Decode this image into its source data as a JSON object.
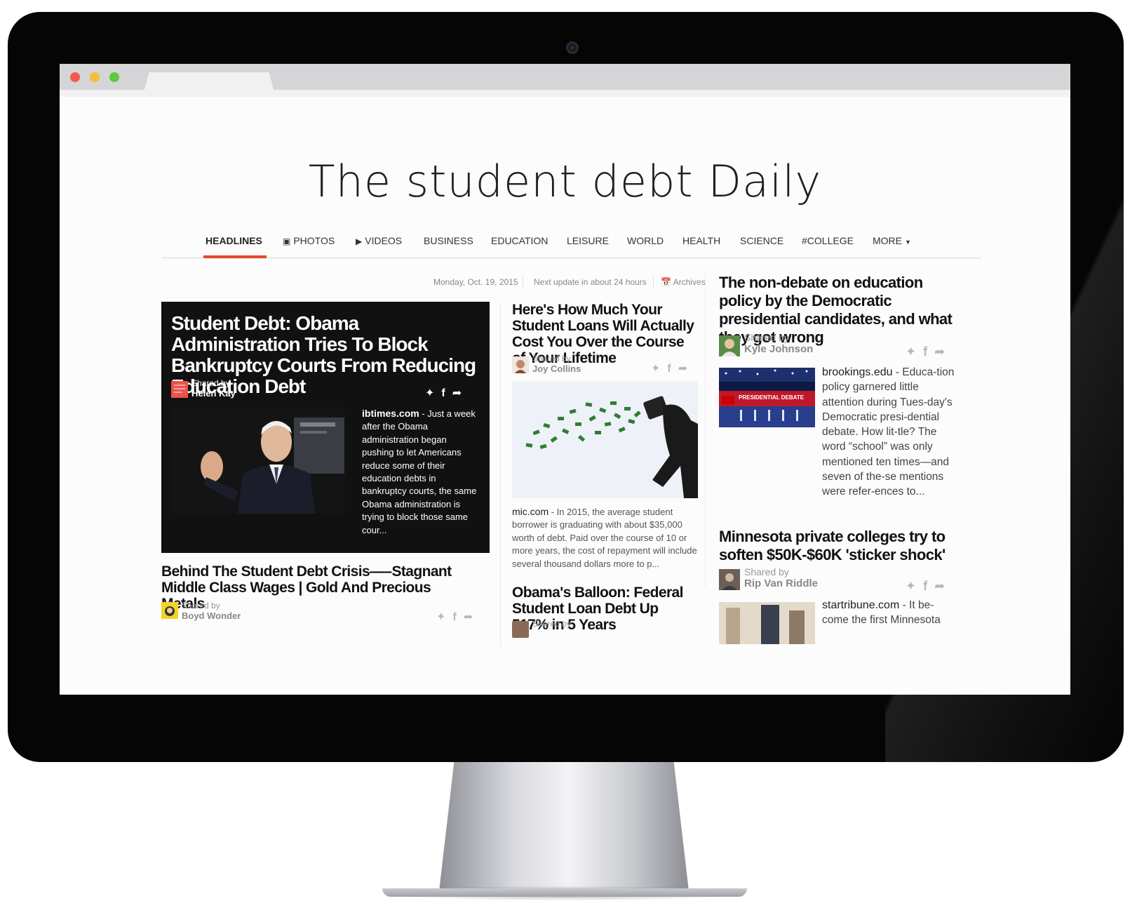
{
  "site": {
    "title": "The student debt Daily"
  },
  "nav": {
    "items": [
      {
        "label": "HEADLINES",
        "icon": ""
      },
      {
        "label": "PHOTOS",
        "icon": "image-icon"
      },
      {
        "label": "VIDEOS",
        "icon": "video-icon"
      },
      {
        "label": "BUSINESS",
        "icon": ""
      },
      {
        "label": "EDUCATION",
        "icon": ""
      },
      {
        "label": "LEISURE",
        "icon": ""
      },
      {
        "label": "WORLD",
        "icon": ""
      },
      {
        "label": "HEALTH",
        "icon": ""
      },
      {
        "label": "SCIENCE",
        "icon": ""
      },
      {
        "label": "#COLLEGE",
        "icon": ""
      },
      {
        "label": "MORE",
        "icon": "caret-down-icon"
      }
    ],
    "active": "HEADLINES",
    "accent": "#e44a2e"
  },
  "meta": {
    "date": "Monday, Oct. 19, 2015",
    "next_update": "Next update in about 24 hours",
    "archives": "Archives"
  },
  "articles": {
    "feature": {
      "title": "Student Debt: Obama Administration Tries To Block Bankruptcy Courts From Reducing Education Debt",
      "shared_by_label": "Shared by",
      "sharer": "Helen Kay",
      "source": "ibtimes.com",
      "snippet": " - Just a week after the Obama administration began pushing to let Americans reduce some of their education debts in bankruptcy courts, the same Obama administration is trying to block those same cour..."
    },
    "left2": {
      "title": "Behind The Student Debt Crisis—–Stagnant Middle Class Wages | Gold And Precious Metals",
      "shared_by_label": "Shared by",
      "sharer": "Boyd Wonder"
    },
    "mid1": {
      "title": "Here's How Much Your Student Loans Will Actually Cost You Over the Course of Your Lifetime",
      "shared_by_label": "Shared by",
      "sharer": "Joy Collins",
      "source": "mic.com",
      "snippet": " - In 2015, the average student borrower is graduating with about $35,000 worth of debt. Paid over the course of 10 or more years, the cost of repayment will include several thousand dollars more to p..."
    },
    "mid2": {
      "title": "Obama's Balloon: Federal Student Loan Debt Up 517% in 5 Years",
      "shared_by_label": "Shared by"
    },
    "right1": {
      "title": "The non-debate on education policy by the Democratic presidential candidates, and what they got wrong",
      "shared_by_label": "Shared by",
      "sharer": "Kyle Johnson",
      "source": "brookings.edu",
      "snippet": " - Educa-tion policy garnered little attention during Tues-day's Democratic presi-dential debate. How lit-tle? The word “school” was only mentioned ten times—and seven of the-se mentions were refer-ences to...",
      "image_caption": "PRESIDENTIAL DEBATE"
    },
    "right2": {
      "title": "Minnesota private colleges try to soften $50K-$60K 'sticker shock'",
      "shared_by_label": "Shared by",
      "sharer": "Rip Van Riddle",
      "source": "startribune.com",
      "snippet": " - It be-come the first Minnesota"
    }
  },
  "social_icons": [
    "twitter-icon",
    "facebook-icon",
    "share-icon"
  ]
}
